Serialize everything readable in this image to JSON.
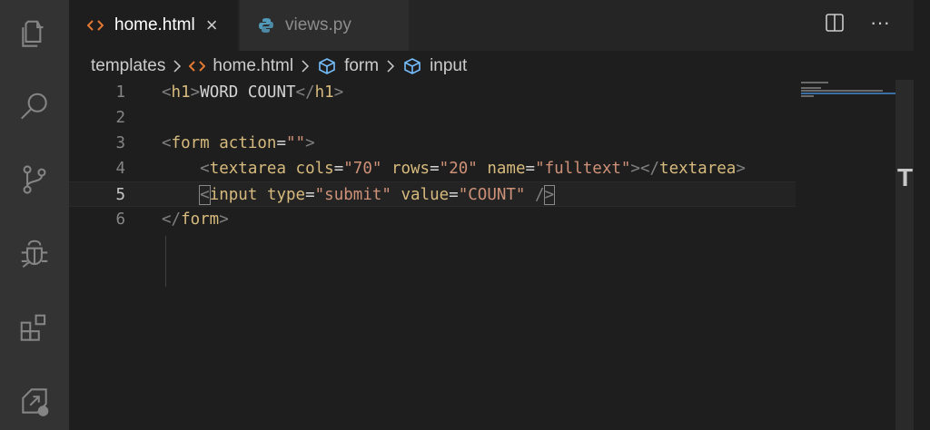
{
  "activity_bar": {
    "items": [
      "explorer-icon",
      "search-icon",
      "source-control-icon",
      "debug-icon",
      "extensions-icon",
      "remote-icon"
    ]
  },
  "tabs": [
    {
      "label": "home.html",
      "icon": "html-icon",
      "active": true,
      "close": "×"
    },
    {
      "label": "views.py",
      "icon": "python-icon",
      "active": false
    }
  ],
  "tab_actions": {
    "split": "split-editor-icon",
    "more": "···"
  },
  "breadcrumb": [
    {
      "label": "templates",
      "icon": ""
    },
    {
      "label": "home.html",
      "icon": "html-icon"
    },
    {
      "label": "form",
      "icon": "element-icon"
    },
    {
      "label": "input",
      "icon": "element-icon"
    }
  ],
  "editor": {
    "line_numbers": [
      "1",
      "2",
      "3",
      "4",
      "5",
      "6"
    ],
    "current_line": 5,
    "lines": [
      [
        {
          "t": "tag",
          "v": "<"
        },
        {
          "t": "name",
          "v": "h1"
        },
        {
          "t": "tag",
          "v": ">"
        },
        {
          "t": "text",
          "v": "WORD COUNT"
        },
        {
          "t": "tag",
          "v": "</"
        },
        {
          "t": "name",
          "v": "h1"
        },
        {
          "t": "tag",
          "v": ">"
        }
      ],
      [],
      [
        {
          "t": "tag",
          "v": "<"
        },
        {
          "t": "name",
          "v": "form"
        },
        {
          "t": "text",
          "v": " "
        },
        {
          "t": "attr",
          "v": "action"
        },
        {
          "t": "text",
          "v": "="
        },
        {
          "t": "str",
          "v": "\"\""
        },
        {
          "t": "tag",
          "v": ">"
        }
      ],
      [
        {
          "t": "text",
          "v": "    "
        },
        {
          "t": "tag",
          "v": "<"
        },
        {
          "t": "name",
          "v": "textarea"
        },
        {
          "t": "text",
          "v": " "
        },
        {
          "t": "attr",
          "v": "cols"
        },
        {
          "t": "text",
          "v": "="
        },
        {
          "t": "str",
          "v": "\"70\""
        },
        {
          "t": "text",
          "v": " "
        },
        {
          "t": "attr",
          "v": "rows"
        },
        {
          "t": "text",
          "v": "="
        },
        {
          "t": "str",
          "v": "\"20\""
        },
        {
          "t": "text",
          "v": " "
        },
        {
          "t": "attr",
          "v": "name"
        },
        {
          "t": "text",
          "v": "="
        },
        {
          "t": "str",
          "v": "\"fulltext\""
        },
        {
          "t": "tag",
          "v": "></"
        },
        {
          "t": "name",
          "v": "textarea"
        },
        {
          "t": "tag",
          "v": ">"
        }
      ],
      [
        {
          "t": "text",
          "v": "    "
        },
        {
          "t": "tag",
          "v": "<",
          "m": true
        },
        {
          "t": "name",
          "v": "input"
        },
        {
          "t": "text",
          "v": " "
        },
        {
          "t": "attr",
          "v": "type"
        },
        {
          "t": "text",
          "v": "="
        },
        {
          "t": "str",
          "v": "\"submit\""
        },
        {
          "t": "text",
          "v": " "
        },
        {
          "t": "attr",
          "v": "value"
        },
        {
          "t": "text",
          "v": "="
        },
        {
          "t": "str",
          "v": "\"COUNT\""
        },
        {
          "t": "text",
          "v": " "
        },
        {
          "t": "tag",
          "v": "/"
        },
        {
          "t": "tag",
          "v": ">",
          "m": true
        }
      ],
      [
        {
          "t": "tag",
          "v": "</"
        },
        {
          "t": "name",
          "v": "form"
        },
        {
          "t": "tag",
          "v": ">"
        }
      ]
    ]
  },
  "overview_ruler_mark": "T",
  "colors": {
    "background": "#1e1e1e",
    "activity_bar": "#333333",
    "tab_inactive": "#2d2d2d",
    "tag_punct": "#808080",
    "tag_name": "#d7ba7d",
    "string": "#ce9178",
    "html_icon": "#e37933",
    "python_icon": "#519aba",
    "element_icon": "#75beff"
  }
}
